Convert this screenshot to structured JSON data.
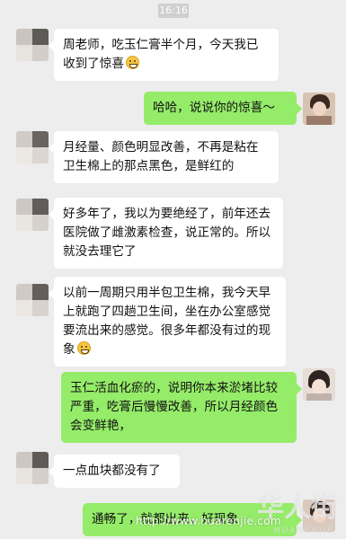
{
  "status": {
    "time": "16:16"
  },
  "messages": [
    {
      "side": "left",
      "text": "周老师，吃玉仁膏半个月，今天我已收到了惊喜",
      "emoji": "grin-emoji"
    },
    {
      "side": "right",
      "text": "哈哈，说说你的惊喜～"
    },
    {
      "side": "left",
      "text": "月经量、颜色明显改善，不再是粘在卫生棉上的那点黑色，是鲜红的"
    },
    {
      "side": "left",
      "text": "好多年了，我以为要绝经了，前年还去医院做了雌激素检查，说正常的。所以就没去理它了"
    },
    {
      "side": "left",
      "text": "以前一周期只用半包卫生棉，我今天早上就跑了四趟卫生间，坐在办公室感觉要流出来的感觉。很多年都没有过的现象",
      "emoji": "grin-emoji"
    },
    {
      "side": "right",
      "text": "玉仁活血化瘀的，说明你本来淤堵比较严重，吃膏后慢慢改善，所以月经颜色会变鲜艳，"
    },
    {
      "side": "left",
      "text": "一点血块都没有了"
    },
    {
      "side": "right",
      "text": "通畅了，就都出来，好现象"
    }
  ],
  "watermark": {
    "url": "http://www.huarenjie.com",
    "brand": "华人街",
    "sub": "HUARENJIE"
  }
}
